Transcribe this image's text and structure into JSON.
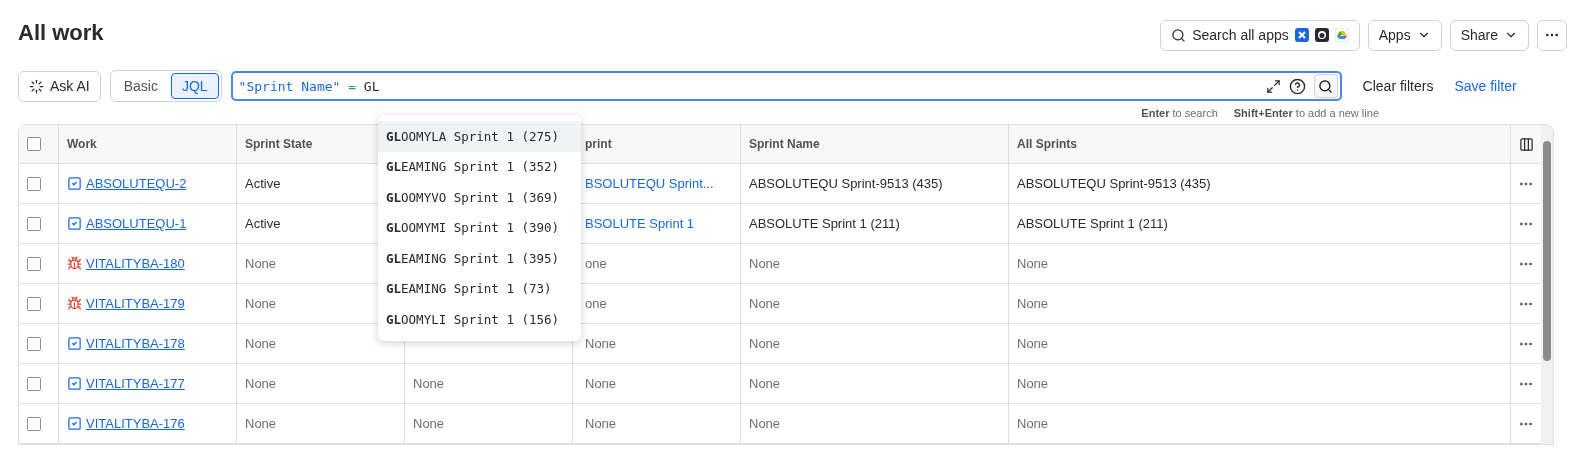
{
  "title": "All work",
  "header_actions": {
    "search_apps": "Search all apps",
    "apps": "Apps",
    "share": "Share"
  },
  "ask_ai": "Ask AI",
  "mode_toggle": [
    {
      "label": "Basic",
      "selected": false
    },
    {
      "label": "JQL",
      "selected": true
    }
  ],
  "query": {
    "field": "\"Sprint Name\"",
    "operator": "=",
    "value": "GL"
  },
  "clear_filters": "Clear filters",
  "save_filter": "Save filter",
  "hints": [
    "**Enter** to search",
    "**Shift+Enter** to add a new line"
  ],
  "suggestions": [
    {
      "label": "**GL**OOMYLA Sprint 1 (275)",
      "selected": true
    },
    {
      "label": "**GL**EAMING Sprint 1 (352)",
      "selected": false
    },
    {
      "label": "**GL**OOMYVO Sprint 1 (369)",
      "selected": false
    },
    {
      "label": "**GL**OOMYMI Sprint 1 (390)",
      "selected": false
    },
    {
      "label": "**GL**EAMING Sprint 1 (395)",
      "selected": false
    },
    {
      "label": "**GL**EAMING Sprint 1 (73)",
      "selected": false
    },
    {
      "label": "**GL**OOMYLI Sprint 1 (156)",
      "selected": false
    }
  ],
  "table": {
    "header_checked": false,
    "work_column": "Work",
    "columns": [
      "Sprint State",
      null,
      "print",
      "Sprint Name",
      "All Sprints"
    ],
    "rows": [
      {
        "checked": false,
        "kind": "story",
        "key": "ABSOLUTEQU-2",
        "cells": [
          {
            "text": "Active",
            "kind": "value"
          },
          null,
          {
            "text": "BSOLUTEQU Sprint...",
            "kind": "link"
          },
          {
            "text": "ABSOLUTEQU Sprint-9513 (435)",
            "kind": "value"
          },
          {
            "text": "ABSOLUTEQU Sprint-9513 (435)",
            "kind": "value"
          }
        ]
      },
      {
        "checked": false,
        "kind": "story",
        "key": "ABSOLUTEQU-1",
        "cells": [
          {
            "text": "Active",
            "kind": "value"
          },
          null,
          {
            "text": "BSOLUTE Sprint 1",
            "kind": "link"
          },
          {
            "text": "ABSOLUTE Sprint 1 (211)",
            "kind": "value"
          },
          {
            "text": "ABSOLUTE Sprint 1 (211)",
            "kind": "value"
          }
        ]
      },
      {
        "checked": false,
        "kind": "bug",
        "key": "VITALITYBA-180",
        "cells": [
          {
            "text": "None",
            "kind": "empty"
          },
          null,
          {
            "text": "one",
            "kind": "empty"
          },
          {
            "text": "None",
            "kind": "empty"
          },
          {
            "text": "None",
            "kind": "empty"
          }
        ]
      },
      {
        "checked": false,
        "kind": "bug",
        "key": "VITALITYBA-179",
        "cells": [
          {
            "text": "None",
            "kind": "empty"
          },
          null,
          {
            "text": "one",
            "kind": "empty"
          },
          {
            "text": "None",
            "kind": "empty"
          },
          {
            "text": "None",
            "kind": "empty"
          }
        ]
      },
      {
        "checked": false,
        "kind": "story",
        "key": "VITALITYBA-178",
        "cells": [
          {
            "text": "None",
            "kind": "empty"
          },
          null,
          {
            "text": "None",
            "kind": "empty"
          },
          {
            "text": "None",
            "kind": "empty"
          },
          {
            "text": "None",
            "kind": "empty"
          }
        ]
      },
      {
        "checked": false,
        "kind": "story",
        "key": "VITALITYBA-177",
        "cells": [
          {
            "text": "None",
            "kind": "empty"
          },
          {
            "text": "None",
            "kind": "empty"
          },
          {
            "text": "None",
            "kind": "empty"
          },
          {
            "text": "None",
            "kind": "empty"
          },
          {
            "text": "None",
            "kind": "empty"
          }
        ]
      },
      {
        "checked": false,
        "kind": "story",
        "key": "VITALITYBA-176",
        "cells": [
          {
            "text": "None",
            "kind": "empty"
          },
          {
            "text": "None",
            "kind": "empty"
          },
          {
            "text": "None",
            "kind": "empty"
          },
          {
            "text": "None",
            "kind": "empty"
          },
          {
            "text": "None",
            "kind": "empty"
          }
        ]
      }
    ]
  }
}
